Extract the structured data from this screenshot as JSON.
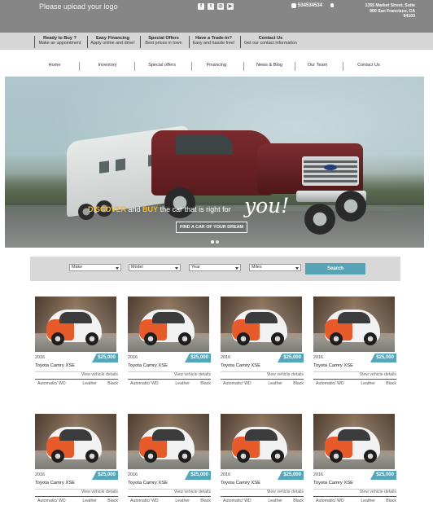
{
  "header": {
    "logo_text": "Please upload your logo",
    "social_icons": [
      "facebook-icon",
      "twitter-icon",
      "instagram-icon",
      "youtube-icon"
    ],
    "phone": "534534534",
    "address_line1": "1355 Market Street, Suite",
    "address_line2": "900 San Francisco, CA",
    "address_line3": "94103"
  },
  "promo": [
    {
      "title": "Ready to Buy ?",
      "subtitle": "Make an appointment"
    },
    {
      "title": "Easy Financing",
      "subtitle": "Apply online and drive!"
    },
    {
      "title": "Special Offers",
      "subtitle": "Best prices in town"
    },
    {
      "title": "Have a Trade-in?",
      "subtitle": "Easy and hassle free!"
    },
    {
      "title": "Contact Us",
      "subtitle": "Get our contact information"
    }
  ],
  "nav": [
    "Home",
    "Inventory",
    "Special offers",
    "Financing",
    "News & Blog",
    "Our Team",
    "Contact Us"
  ],
  "hero": {
    "headline_part1": "DISCOVER",
    "headline_part2": " and ",
    "headline_part3": "BUY",
    "headline_part4": " the car that is right for ",
    "headline_script": "you!",
    "cta_label": "FIND A CAR OF YOUR DREAM",
    "slide_count": 2,
    "active_slide": 1
  },
  "search": {
    "make": "Make",
    "model": "Model",
    "year": "Year",
    "miles": "Miles",
    "button_label": "Search"
  },
  "listings": [
    {
      "year": "2016",
      "price": "$25,000",
      "title": "Toyota Camry XSE",
      "details_link": "View vehicle details",
      "transmission": "Automatic",
      "drive": "WD",
      "interior": "Leather",
      "color": "Black"
    },
    {
      "year": "2016",
      "price": "$25,000",
      "title": "Toyota Camry XSE",
      "details_link": "View vehicle details",
      "transmission": "Automatic",
      "drive": "WD",
      "interior": "Leather",
      "color": "Black"
    },
    {
      "year": "2016",
      "price": "$25,000",
      "title": "Toyota Camry XSE",
      "details_link": "View vehicle details",
      "transmission": "Automatic",
      "drive": "WD",
      "interior": "Leather",
      "color": "Black"
    },
    {
      "year": "2016",
      "price": "$25,000",
      "title": "Toyota Camry XSE",
      "details_link": "View vehicle details",
      "transmission": "Automatic",
      "drive": "WD",
      "interior": "Leather",
      "color": "Black"
    },
    {
      "year": "2016",
      "price": "$25,000",
      "title": "Toyota Camry XSE",
      "details_link": "View vehicle details",
      "transmission": "Automatic",
      "drive": "WD",
      "interior": "Leather",
      "color": "Black"
    },
    {
      "year": "2016",
      "price": "$25,000",
      "title": "Toyota Camry XSE",
      "details_link": "View vehicle details",
      "transmission": "Automatic",
      "drive": "WD",
      "interior": "Leather",
      "color": "Black"
    },
    {
      "year": "2016",
      "price": "$25,000",
      "title": "Toyota Camry XSE",
      "details_link": "View vehicle details",
      "transmission": "Automatic",
      "drive": "WD",
      "interior": "Leather",
      "color": "Black"
    },
    {
      "year": "2016",
      "price": "$25,000",
      "title": "Toyota Camry XSE",
      "details_link": "View vehicle details",
      "transmission": "Automatic",
      "drive": "WD",
      "interior": "Leather",
      "color": "Black"
    }
  ],
  "colors": {
    "topbar": "#868686",
    "promo_strip": "#d6d6d6",
    "accent": "#57a5b8",
    "headline_gold": "#f3b93c"
  }
}
